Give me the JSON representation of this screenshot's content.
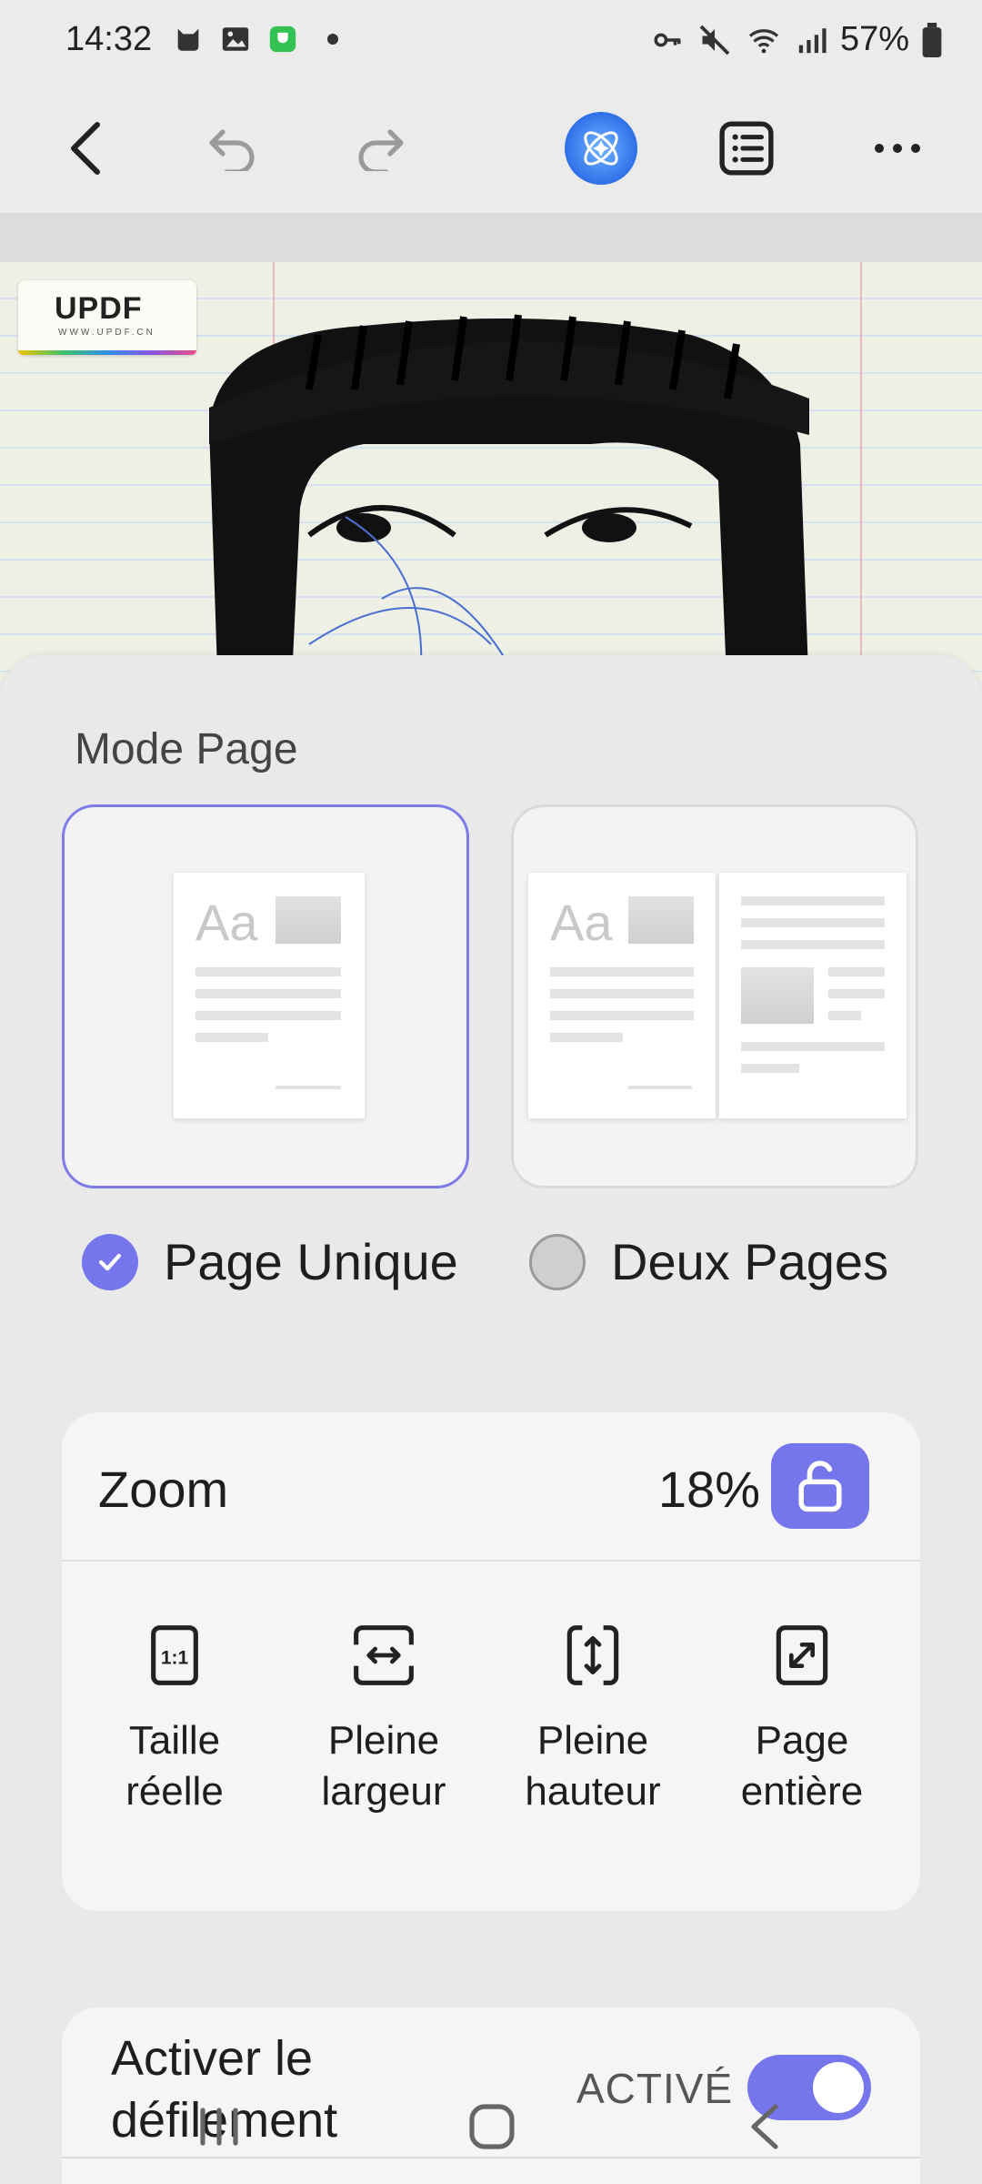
{
  "status_bar": {
    "time": "14:32",
    "battery": "57%",
    "icons_left": [
      "cat-icon",
      "gallery-icon",
      "app-notification-icon",
      "dot-icon"
    ],
    "icons_right": [
      "key-icon",
      "mute-icon",
      "wifi-icon",
      "signal-icon",
      "battery-icon"
    ]
  },
  "toolbar": {
    "buttons": [
      "back-icon",
      "undo-icon",
      "redo-icon",
      "ai-assistant-icon",
      "outline-icon",
      "more-icon"
    ]
  },
  "document": {
    "logo_text": "UPDF",
    "logo_subtext": "WWW.UPDF.CN"
  },
  "sheet": {
    "title": "Mode Page",
    "modes": [
      {
        "label": "Page Unique",
        "selected": true,
        "thumb_text": "Aa"
      },
      {
        "label": "Deux Pages",
        "selected": false,
        "thumb_text": "Aa"
      }
    ],
    "zoom": {
      "label": "Zoom",
      "value": "18%",
      "options": [
        {
          "icon": "actual-size-icon",
          "line1": "Taille",
          "line2": "réelle",
          "glyph": "1:1"
        },
        {
          "icon": "fit-width-icon",
          "line1": "Pleine",
          "line2": "largeur"
        },
        {
          "icon": "fit-height-icon",
          "line1": "Pleine",
          "line2": "hauteur"
        },
        {
          "icon": "fit-page-icon",
          "line1": "Page",
          "line2": "entière"
        }
      ]
    },
    "scroll": {
      "line1": "Activer le",
      "line2": "défilement",
      "state": "ACTIVÉ",
      "enabled": true
    }
  },
  "colors": {
    "accent": "#7676ec",
    "background": "#ebebeb"
  }
}
